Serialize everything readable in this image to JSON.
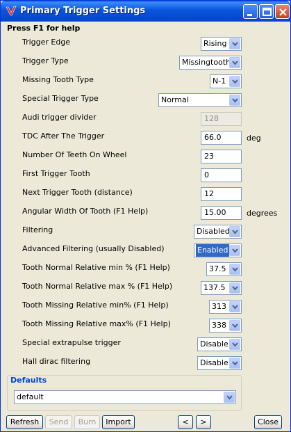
{
  "window": {
    "title": "Primary Trigger Settings",
    "help_text": "Press F1 for help"
  },
  "fields": [
    {
      "label": "Trigger Edge",
      "value": "Rising"
    },
    {
      "label": "Trigger Type",
      "value": "Missingtooth"
    },
    {
      "label": "Missing Tooth Type",
      "value": "N-1"
    },
    {
      "label": "Special Trigger Type",
      "value": "Normal"
    },
    {
      "label": "Audi trigger divider",
      "value": "128"
    },
    {
      "label": "TDC After The Trigger",
      "value": "66.0",
      "unit": "deg"
    },
    {
      "label": "Number Of Teeth On Wheel",
      "value": "23"
    },
    {
      "label": "First Trigger Tooth",
      "value": "0"
    },
    {
      "label": "Next Trigger Tooth (distance)",
      "value": "12"
    },
    {
      "label": "Angular Width Of Tooth (F1 Help)",
      "value": "15.00",
      "unit": "degrees"
    },
    {
      "label": "Filtering",
      "value": "Disabled"
    },
    {
      "label": "Advanced Filtering (usually Disabled)",
      "value": "Enabled"
    },
    {
      "label": "Tooth Normal Relative min % (F1 Help)",
      "value": "37.5"
    },
    {
      "label": "Tooth Normal Relative max % (F1 Help)",
      "value": "137.5"
    },
    {
      "label": "Tooth Missing Relative min% (F1 Help)",
      "value": "313"
    },
    {
      "label": "Tooth Missing Relative max% (F1 Help)",
      "value": "338"
    },
    {
      "label": "Special extrapulse trigger",
      "value": "Disable"
    },
    {
      "label": "Hall dirac filtering",
      "value": "Disable"
    }
  ],
  "defaults": {
    "title": "Defaults",
    "value": "default"
  },
  "buttons": {
    "refresh": "Refresh",
    "send": "Send",
    "burn": "Burn",
    "import": "Import",
    "prev": "<",
    "next": ">",
    "close": "Close"
  },
  "colors": {
    "title_bar": "#0855dd",
    "selection": "#316ac5",
    "group_title": "#0046d5"
  }
}
